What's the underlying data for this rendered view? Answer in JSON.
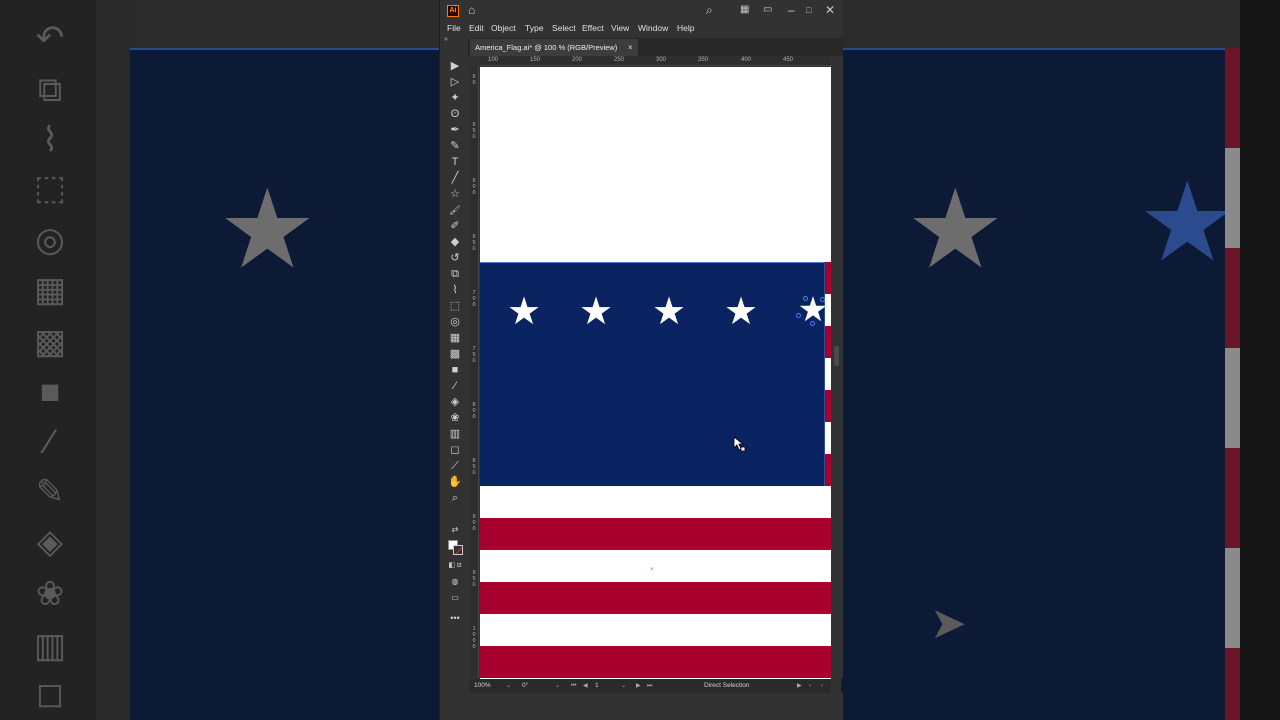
{
  "window": {
    "app_logo": "Ai",
    "title_bar_icons": [
      "home-icon",
      "search-icon",
      "arrange-documents-icon",
      "workspace-icon",
      "minimize-icon",
      "maximize-icon",
      "close-icon"
    ]
  },
  "menu": {
    "items": [
      "File",
      "Edit",
      "Object",
      "Type",
      "Select",
      "Effect",
      "View",
      "Window",
      "Help"
    ]
  },
  "document_tab": {
    "label": "America_Flag.ai* @ 100 % (RGB/Preview)",
    "close": "×"
  },
  "rulers": {
    "horizontal": [
      "100",
      "150",
      "200",
      "250",
      "300",
      "350",
      "400",
      "450"
    ],
    "vertical": [
      [
        "5",
        "0"
      ],
      [
        "5",
        "5",
        "0"
      ],
      [
        "6",
        "0",
        "0"
      ],
      [
        "6",
        "5",
        "0"
      ],
      [
        "7",
        "0",
        "0"
      ],
      [
        "7",
        "5",
        "0"
      ],
      [
        "8",
        "0",
        "0"
      ],
      [
        "8",
        "5",
        "0"
      ],
      [
        "9",
        "0",
        "0"
      ],
      [
        "9",
        "5",
        "0"
      ],
      [
        "1",
        "0",
        "0",
        "0"
      ]
    ]
  },
  "tools": [
    "selection-tool-icon",
    "direct-selection-tool-icon",
    "magic-wand-tool-icon",
    "lasso-tool-icon",
    "pen-tool-icon",
    "curvature-tool-icon",
    "type-tool-icon",
    "line-segment-tool-icon",
    "star-tool-icon",
    "paintbrush-tool-icon",
    "shaper-tool-icon",
    "eraser-tool-icon",
    "rotate-tool-icon",
    "scale-tool-icon",
    "warp-tool-icon",
    "free-transform-tool-icon",
    "shape-builder-tool-icon",
    "perspective-grid-tool-icon",
    "mesh-tool-icon",
    "gradient-tool-icon",
    "eyedropper-tool-icon",
    "blend-tool-icon",
    "symbol-sprayer-tool-icon",
    "column-graph-tool-icon",
    "artboard-tool-icon",
    "slice-tool-icon",
    "hand-tool-icon",
    "zoom-tool-icon"
  ],
  "tool_glyphs": [
    "▶",
    "▷",
    "✦",
    "ʘ",
    "✒",
    "✎",
    "T",
    "╱",
    "☆",
    "🖌",
    "✐",
    "◆",
    "↺",
    "⧉",
    "⌇",
    "⬚",
    "◎",
    "▦",
    "▩",
    "■",
    "⁄",
    "◈",
    "❀",
    "▥",
    "◻",
    "⟋",
    "✋",
    "⌕"
  ],
  "colors": {
    "fill": "#ffffff",
    "stroke": "none",
    "flag_blue": "#0a2461",
    "flag_red": "#a6002f",
    "selection": "#4d7bff"
  },
  "artwork": {
    "stars": [
      "★",
      "★",
      "★",
      "★"
    ],
    "selected_star": "★"
  },
  "status_bar": {
    "zoom": "100%",
    "rotation": "0°",
    "artboard_number": "1",
    "current_tool": "Direct Selection"
  },
  "background_readout": [
    "6",
    "5",
    "0",
    "7",
    "0",
    "0",
    "7",
    "5",
    "0",
    "8",
    "0",
    "0",
    "8",
    "5",
    "0",
    "9"
  ]
}
